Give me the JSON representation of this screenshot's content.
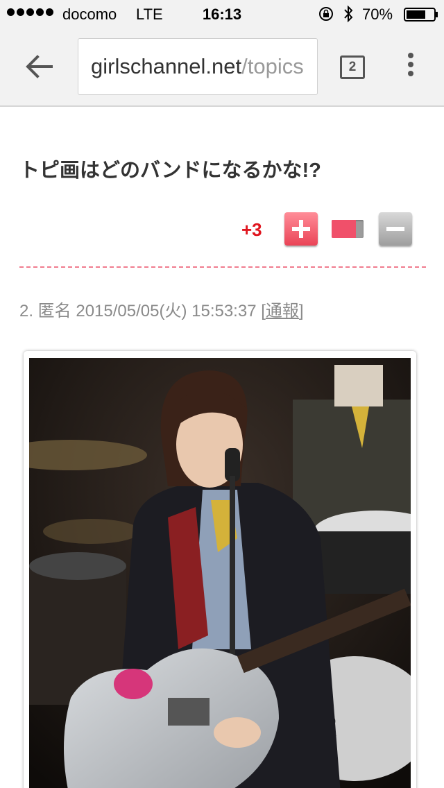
{
  "status_bar": {
    "carrier": "docomo",
    "network": "LTE",
    "time": "16:13",
    "battery": "70%",
    "battery_level": 0.7,
    "icons": [
      "signal-dots",
      "orientation-lock-icon",
      "bluetooth-icon",
      "battery-icon"
    ]
  },
  "browser": {
    "url_host": "girlschannel.net",
    "url_path": "/topics",
    "tab_count": "2",
    "icons": [
      "back-arrow-icon",
      "tabs-icon",
      "overflow-menu-icon"
    ]
  },
  "topic": {
    "title": "トピ画はどのバンドになるかな!?",
    "score": "+3",
    "vote_ratio": 0.75
  },
  "comment": {
    "meta": "2. 匿名 2015/05/05(火) 15:53:37 ",
    "report_open": "[",
    "report_label": "通報",
    "report_close": "]"
  },
  "colors": {
    "accent_red": "#e0151f",
    "plus_pink": "#ea4457",
    "divider_pink": "#f07b8e"
  }
}
